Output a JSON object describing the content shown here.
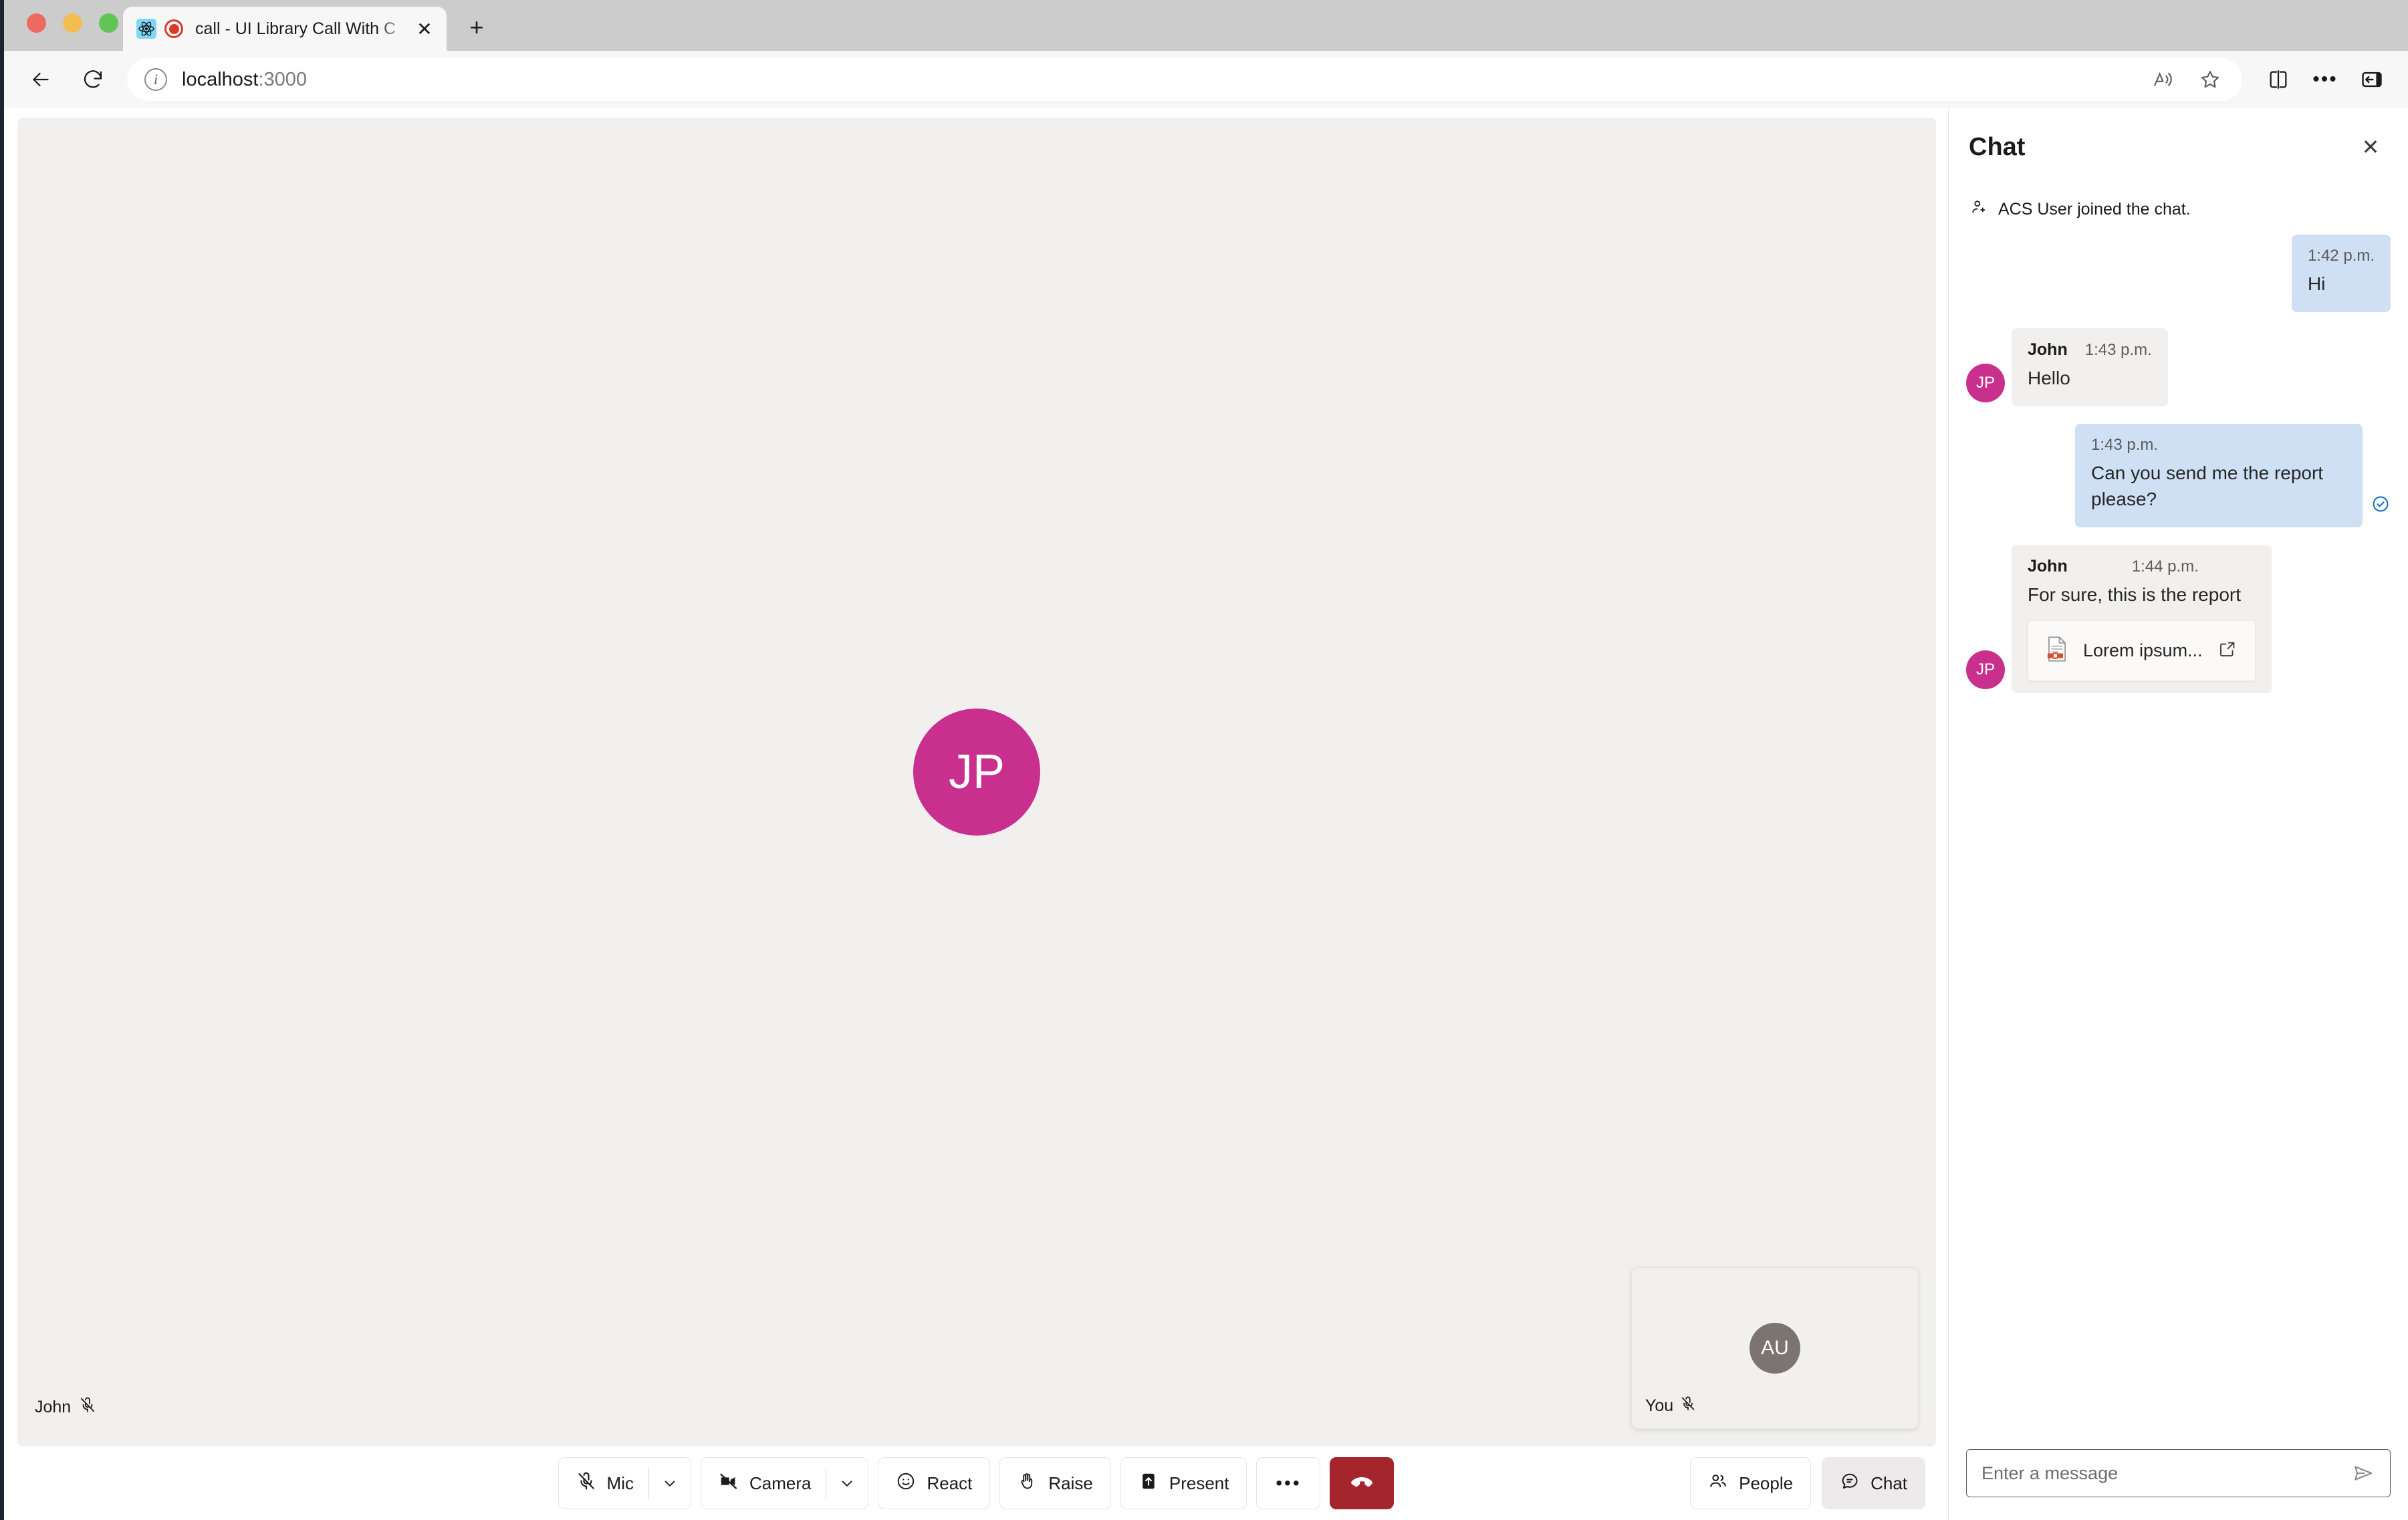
{
  "browser": {
    "window_controls": {
      "close": "close",
      "minimize": "minimize",
      "maximize": "maximize"
    },
    "tab": {
      "title": "call - UI Library Call With C",
      "favicon": "react-favicon",
      "recording_indicator": "recording-dot-icon",
      "close_label": "✕"
    },
    "new_tab_label": "+",
    "toolbar": {
      "back": "back-arrow-icon",
      "reload": "reload-icon",
      "site_info": "i",
      "url": "localhost",
      "url_port": ":3000",
      "read_aloud": "read-aloud-icon",
      "favorites": "star-icon",
      "split_screen": "split-screen-icon",
      "more": "•••",
      "sidebar": "sidebar-toggle-icon"
    }
  },
  "call": {
    "remote_participant": {
      "initials": "JP",
      "name": "John",
      "muted": true,
      "avatar_color": "#c9308e"
    },
    "local_participant": {
      "initials": "AU",
      "name": "You",
      "muted": true,
      "avatar_color": "#7b7470"
    },
    "controls": [
      {
        "id": "mic",
        "label": "Mic",
        "icon": "mic-off-icon",
        "has_caret": true,
        "caret": "⌄"
      },
      {
        "id": "camera",
        "label": "Camera",
        "icon": "camera-off-icon",
        "has_caret": true,
        "caret": "⌄"
      },
      {
        "id": "react",
        "label": "React",
        "icon": "emoji-icon",
        "has_caret": false
      },
      {
        "id": "raise",
        "label": "Raise",
        "icon": "raise-hand-icon",
        "has_caret": false
      },
      {
        "id": "present",
        "label": "Present",
        "icon": "share-screen-icon",
        "has_caret": false
      },
      {
        "id": "more",
        "label": "•••",
        "icon": "more-options-icon",
        "has_caret": false
      },
      {
        "id": "hangup",
        "label": "",
        "icon": "end-call-icon",
        "has_caret": false
      }
    ],
    "right_controls": [
      {
        "id": "people",
        "label": "People",
        "icon": "people-icon",
        "active": false
      },
      {
        "id": "chat",
        "label": "Chat",
        "icon": "chat-bubble-icon",
        "active": true
      }
    ],
    "colors": {
      "hangup": "#a4262c",
      "active_button": "#eceaea",
      "stage": "#f1f0ef"
    }
  },
  "chat": {
    "title": "Chat",
    "close_label": "✕",
    "system_message": "ACS User joined the chat.",
    "system_icon": "person-add-icon",
    "messages": [
      {
        "direction": "outgoing",
        "author": "",
        "time": "1:42 p.m.",
        "text": "Hi",
        "read_receipt": false,
        "attachment": null
      },
      {
        "direction": "incoming",
        "author": "John",
        "initials": "JP",
        "time": "1:43 p.m.",
        "text": "Hello",
        "read_receipt": false,
        "attachment": null
      },
      {
        "direction": "outgoing",
        "author": "",
        "time": "1:43 p.m.",
        "text": "Can you send me the report please?",
        "read_receipt": true,
        "attachment": null
      },
      {
        "direction": "incoming",
        "author": "John",
        "initials": "JP",
        "time": "1:44 p.m.",
        "text": "For sure, this is the report",
        "read_receipt": false,
        "attachment": {
          "name": "Lorem ipsum...",
          "icon": "pdf-file-icon",
          "open_icon": "open-external-icon"
        }
      }
    ],
    "composer": {
      "placeholder": "Enter a message",
      "value": "",
      "send_icon": "send-icon"
    },
    "colors": {
      "outgoing_bubble": "#cfe0f4",
      "incoming_bubble": "#f1f0ef",
      "read_receipt": "#0f6cbd"
    }
  }
}
